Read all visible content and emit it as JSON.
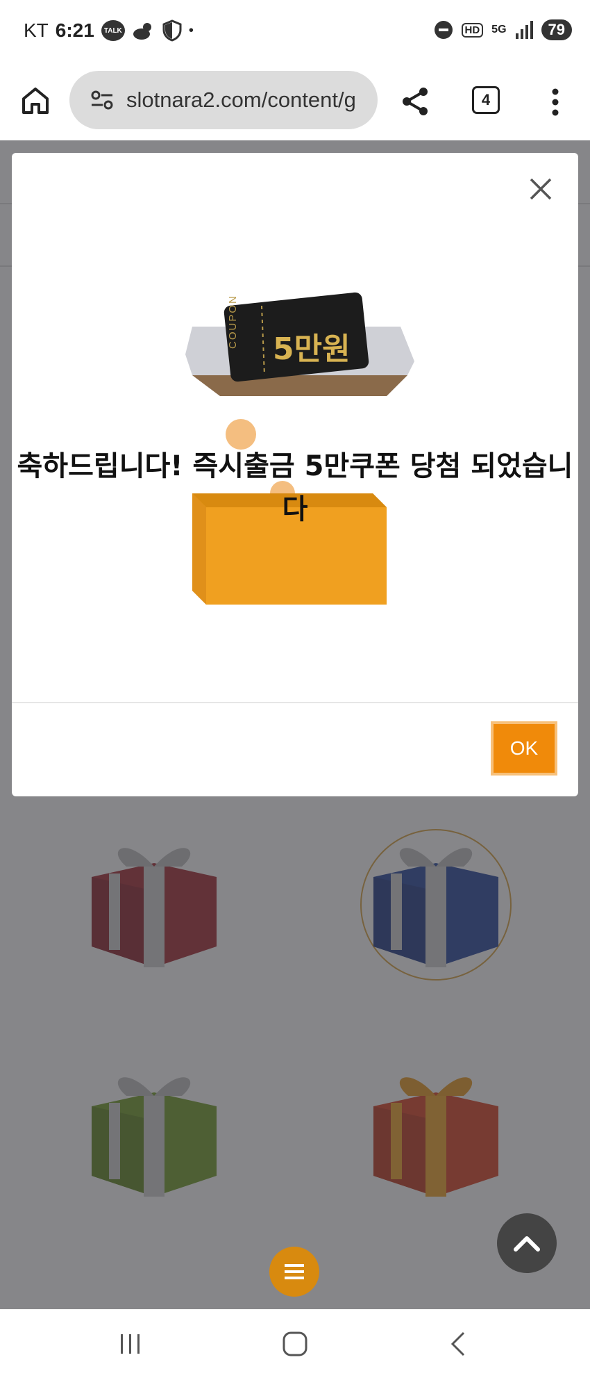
{
  "status_bar": {
    "carrier": "KT",
    "time": "6:21",
    "talk_badge": "TALK",
    "dot": "•",
    "hd": "HD",
    "network": "5G",
    "battery": "79"
  },
  "browser": {
    "url": "slotnara2.com/content/g",
    "tab_count": "4"
  },
  "modal": {
    "coupon_tag": "COUPON",
    "coupon_amount": "5만원",
    "message": "축하드립니다! 즉시출금 5만쿠폰 당첨 되었습니다",
    "ok_label": "OK",
    "accent_color": "#f08a0a"
  },
  "page": {
    "gifts": [
      {
        "color": "#a0222c"
      },
      {
        "color": "#1f3f9a"
      },
      {
        "color": "#6d9a20"
      },
      {
        "color": "#d83a1c"
      }
    ]
  }
}
